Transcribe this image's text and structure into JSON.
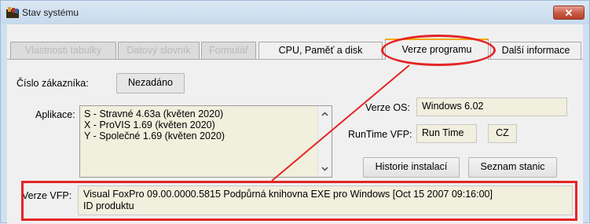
{
  "window": {
    "title": "Stav systému",
    "close_label": "✕"
  },
  "tabs": [
    {
      "label": "Vlastnosti tabulky",
      "state": "disabled"
    },
    {
      "label": "Datový slovník",
      "state": "disabled"
    },
    {
      "label": "Formulář",
      "state": "disabled"
    },
    {
      "label": "CPU, Paměť a disk",
      "state": "normal"
    },
    {
      "label": "Verze programu",
      "state": "active"
    },
    {
      "label": "Další informace",
      "state": "normal"
    }
  ],
  "customer": {
    "label": "Číslo zákazníka:",
    "value": "Nezadáno"
  },
  "applications": {
    "label": "Aplikace:",
    "items": [
      "S - Stravné 4.63a (květen 2020)",
      "X - ProVIS 1.69 (květen 2020)",
      "Y - Společné 1.69 (květen 2020)"
    ]
  },
  "os": {
    "label": "Verze OS:",
    "value": "Windows 6.02"
  },
  "runtime": {
    "label": "RunTime VFP:",
    "value": "Run Time",
    "lang": "CZ"
  },
  "buttons": {
    "history": "Historie instalací",
    "stations": "Seznam stanic"
  },
  "vfp": {
    "label": "Verze VFP:",
    "line1": "Visual FoxPro 09.00.0000.5815 Podpůrná knihovna EXE  pro Windows [Oct 15 2007 09:16:00]",
    "line2": "ID produktu"
  },
  "colors": {
    "annotation": "#e32626",
    "active_tab_accent": "#f2a900",
    "field_bg": "#f1efdd"
  }
}
